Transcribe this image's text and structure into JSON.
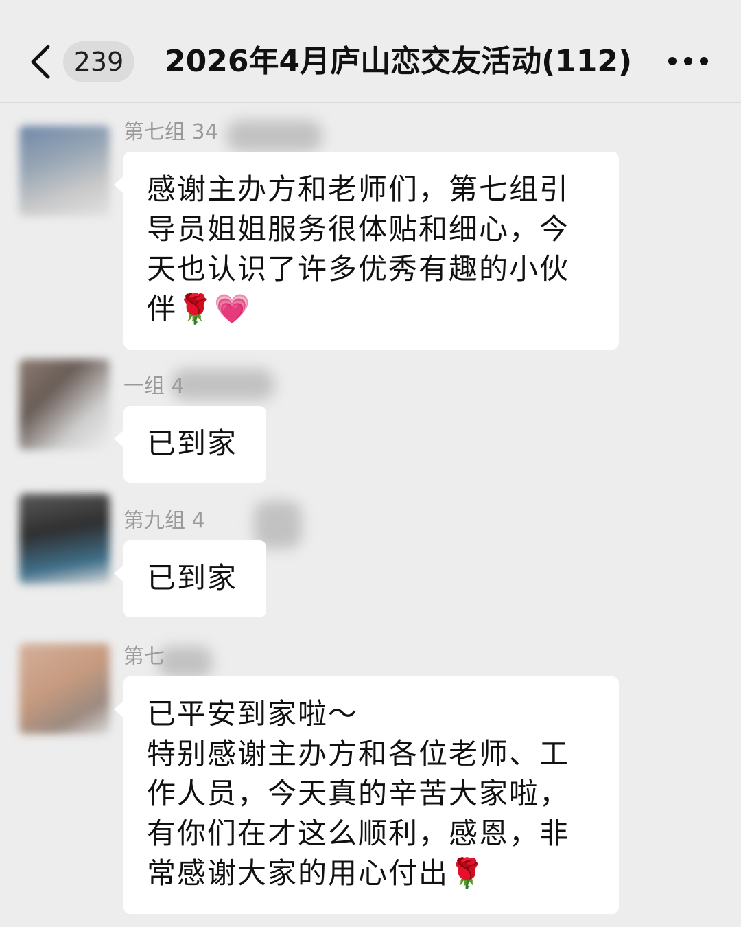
{
  "header": {
    "back_icon": "chevron-left-icon",
    "unread_count": "239",
    "title": "2026年4月庐山恋交友活动(112)",
    "more_icon": "more-dots-icon"
  },
  "messages": [
    {
      "sender": "第七组 34",
      "lines": [
        "感谢主办方和老师们，第七组引",
        "导员姐姐服务很体贴和细心，今",
        "天也认识了许多优秀有趣的小伙",
        "伴🌹💗"
      ]
    },
    {
      "sender": "一组 4",
      "lines": [
        "已到家"
      ]
    },
    {
      "sender": "第九组 4",
      "lines": [
        "已到家"
      ]
    },
    {
      "sender": "第七",
      "lines": [
        "已平安到家啦～",
        "特别感谢主办方和各位老师、工",
        "作人员，今天真的辛苦大家啦，",
        "有你们在才这么顺利，感恩，非",
        "常感谢大家的用心付出🌹"
      ]
    }
  ],
  "colors": {
    "background": "#ededed",
    "bubble": "#ffffff",
    "sender_text": "#9a9a9a"
  }
}
